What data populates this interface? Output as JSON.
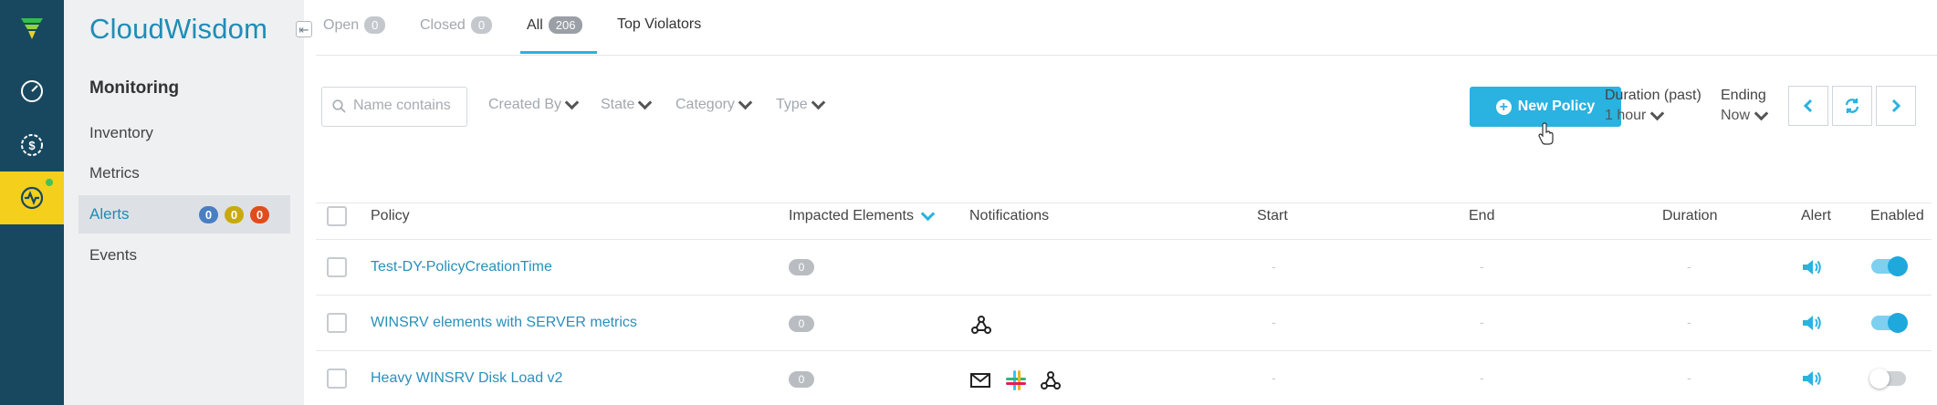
{
  "app": {
    "brand": "CloudWisdom"
  },
  "sidebar": {
    "section_title": "Monitoring",
    "items": [
      {
        "label": "Inventory"
      },
      {
        "label": "Metrics"
      },
      {
        "label": "Alerts",
        "counts": [
          "0",
          "0",
          "0"
        ]
      },
      {
        "label": "Events"
      }
    ]
  },
  "tabs": [
    {
      "label": "Open",
      "count": "0"
    },
    {
      "label": "Closed",
      "count": "0"
    },
    {
      "label": "All",
      "count": "206"
    },
    {
      "label": "Top Violators"
    }
  ],
  "filters": {
    "search_placeholder": "Name contains",
    "items": [
      "Created By",
      "State",
      "Category",
      "Type"
    ]
  },
  "toolbar": {
    "new_policy_label": "New Policy",
    "duration_label": "Duration (past)",
    "duration_value": "1 hour",
    "ending_label": "Ending",
    "ending_value": "Now"
  },
  "table": {
    "columns": [
      "Policy",
      "Impacted Elements",
      "Notifications",
      "Start",
      "End",
      "Duration",
      "Alert",
      "Enabled"
    ],
    "rows": [
      {
        "policy": "Test-DY-PolicyCreationTime",
        "impacted": "0",
        "notifications": [],
        "start": "-",
        "end": "-",
        "duration": "-",
        "enabled": true
      },
      {
        "policy": "WINSRV elements with SERVER metrics",
        "impacted": "0",
        "notifications": [
          "webhook-icon"
        ],
        "start": "-",
        "end": "-",
        "duration": "-",
        "enabled": true
      },
      {
        "policy": "Heavy WINSRV Disk Load v2",
        "impacted": "0",
        "notifications": [
          "email-icon",
          "slack-icon",
          "webhook-icon"
        ],
        "start": "-",
        "end": "-",
        "duration": "-",
        "enabled": false
      }
    ]
  },
  "colors": {
    "rail": "#17485f",
    "accent": "#2ab2e0",
    "active_rail": "#f4cf1c",
    "badge_blue": "#4a7ec2",
    "badge_yellow": "#c9aa0e",
    "badge_red": "#e24b1b"
  }
}
